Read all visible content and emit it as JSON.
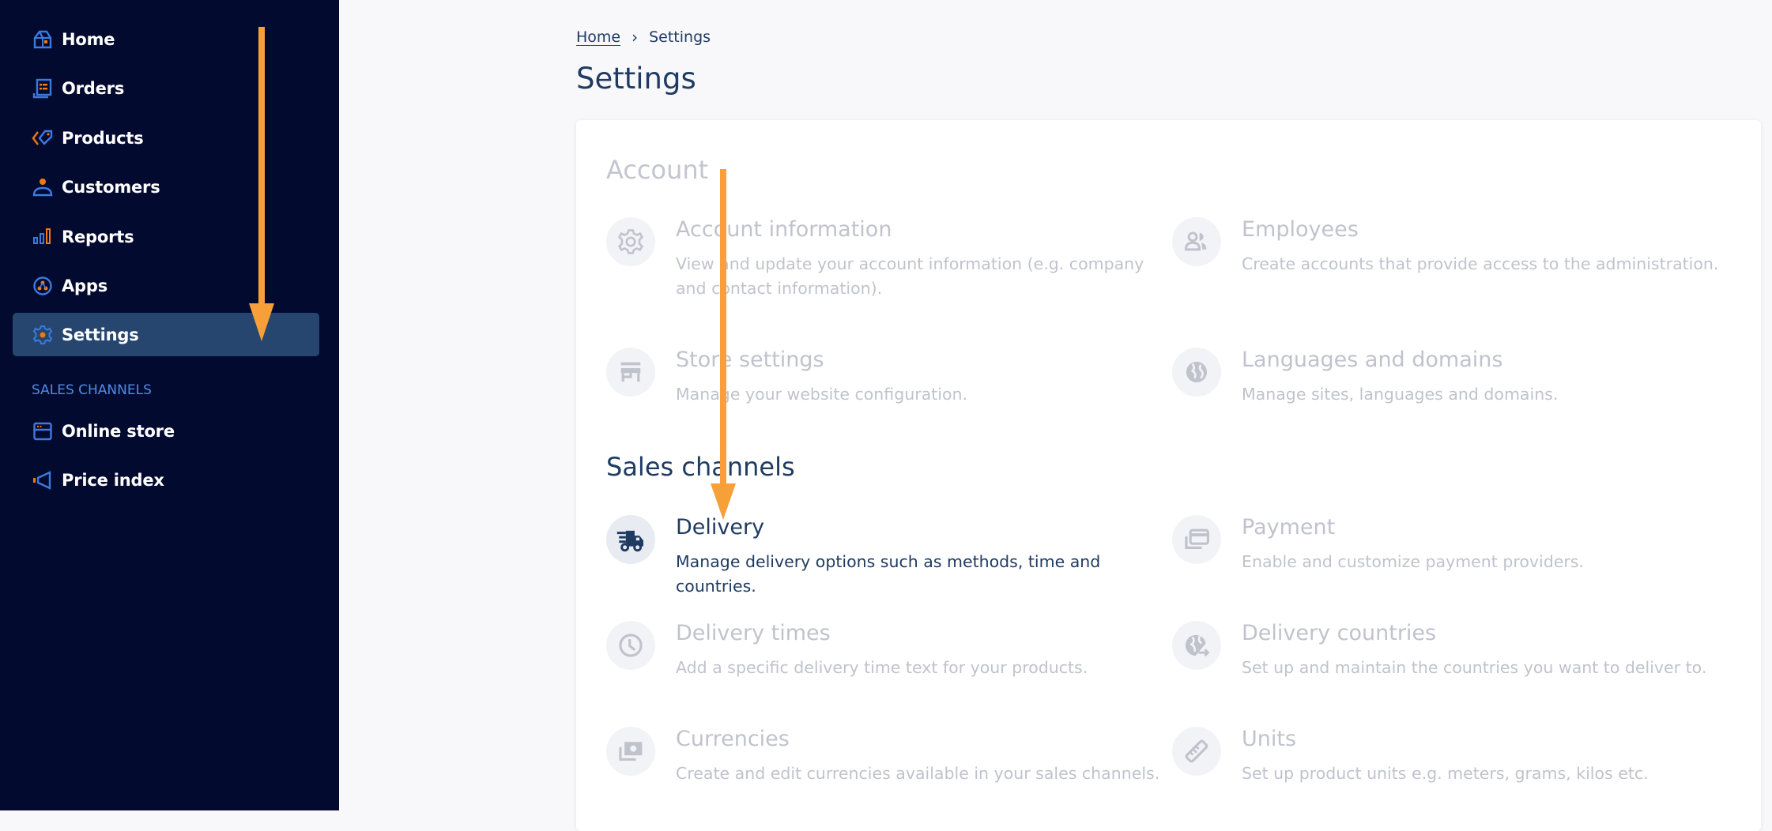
{
  "sidebar": {
    "items": [
      {
        "label": "Home",
        "icon": "home-icon"
      },
      {
        "label": "Orders",
        "icon": "orders-icon"
      },
      {
        "label": "Products",
        "icon": "tag-icon"
      },
      {
        "label": "Customers",
        "icon": "person-icon"
      },
      {
        "label": "Reports",
        "icon": "bar-chart-icon"
      },
      {
        "label": "Apps",
        "icon": "apps-icon"
      },
      {
        "label": "Settings",
        "icon": "gear-icon",
        "active": true
      }
    ],
    "section_label": "SALES CHANNELS",
    "channels": [
      {
        "label": "Online store",
        "icon": "storefront-icon"
      },
      {
        "label": "Price index",
        "icon": "megaphone-icon"
      }
    ]
  },
  "breadcrumb": {
    "home": "Home",
    "separator": "›",
    "current": "Settings"
  },
  "page": {
    "title": "Settings"
  },
  "sections": {
    "account": {
      "title": "Account",
      "tiles": [
        {
          "title": "Account information",
          "desc": "View and update your account information (e.g. company and contact information).",
          "icon": "gear-icon"
        },
        {
          "title": "Employees",
          "desc": "Create accounts that provide access to the administration.",
          "icon": "people-icon"
        },
        {
          "title": "Store settings",
          "desc": "Manage your website configuration.",
          "icon": "store-icon"
        },
        {
          "title": "Languages and domains",
          "desc": "Manage sites, languages and domains.",
          "icon": "globe-icon"
        }
      ]
    },
    "sales": {
      "title": "Sales channels",
      "tiles": [
        {
          "title": "Delivery",
          "desc": "Manage delivery options such as methods, time and countries.",
          "icon": "truck-icon",
          "active": true
        },
        {
          "title": "Payment",
          "desc": "Enable and customize payment providers.",
          "icon": "credit-card-icon"
        },
        {
          "title": "Delivery times",
          "desc": "Add a specific delivery time text for your products.",
          "icon": "clock-icon"
        },
        {
          "title": "Delivery countries",
          "desc": "Set up and maintain the countries you want to deliver to.",
          "icon": "globe-arrow-icon"
        },
        {
          "title": "Currencies",
          "desc": "Create and edit currencies available in your sales channels.",
          "icon": "banknote-icon"
        },
        {
          "title": "Units",
          "desc": "Set up product units e.g. meters, grams, kilos etc.",
          "icon": "ruler-icon"
        }
      ]
    }
  },
  "colors": {
    "sidebar_bg": "#030a2f",
    "sidebar_active": "#26466f",
    "icon_blue": "#3b7be0",
    "icon_orange": "#f07a10",
    "text_dark": "#1f3b62",
    "text_muted": "#c0c3cc",
    "annotation_arrow": "#f7a03a"
  }
}
